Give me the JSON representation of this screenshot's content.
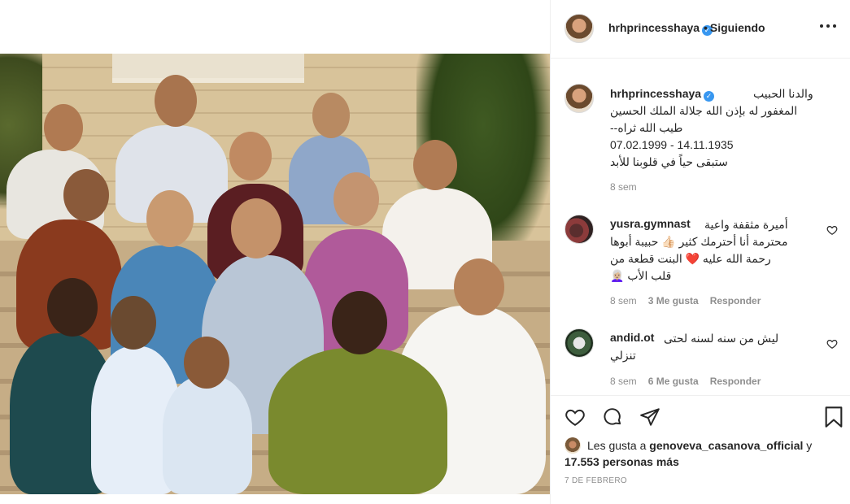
{
  "post": {
    "username": "hrhprincesshaya",
    "follow_separator": "•",
    "follow_status": "Siguiendo",
    "caption_lines": [
      "والدنا الحبيب",
      "المغفور له بإذن الله جلالة الملك الحسين",
      "طيب الله ثراه--",
      "14.11.1935 - 07.02.1999",
      "ستبقى حياً في قلوبنا للأبد"
    ],
    "caption_time": "8 sem"
  },
  "comments": [
    {
      "username": "yusra.gymnast",
      "lines": [
        "أميرة مثقفة واعية",
        "محترمة أنا أحترمك كثير 👍🏻 حبيبة أبوها",
        "رحمة الله عليه ❤️ البنت قطعة من",
        "قلب الأب 👩🏼‍🦳"
      ],
      "time": "8 sem",
      "likes": "3 Me gusta",
      "reply": "Responder"
    },
    {
      "username": "andid.ot",
      "lines": [
        "ليش من سنه لسنه لحتى",
        "تنزلي"
      ],
      "time": "8 sem",
      "likes": "6 Me gusta",
      "reply": "Responder"
    }
  ],
  "likes": {
    "prefix": "Les gusta a",
    "user": "genoveva_casanova_official",
    "conj": "y",
    "count": "17.553 personas más"
  },
  "date": "7 DE FEBRERO",
  "colors": {
    "verified": "#3897f0",
    "text": "#262626",
    "muted": "#8e8e8e",
    "border": "#efefef"
  },
  "icons": {
    "verified": "verified-badge-icon",
    "more": "more-options-icon",
    "like": "heart-icon",
    "comment": "comment-icon",
    "share": "share-icon",
    "save": "bookmark-icon"
  }
}
